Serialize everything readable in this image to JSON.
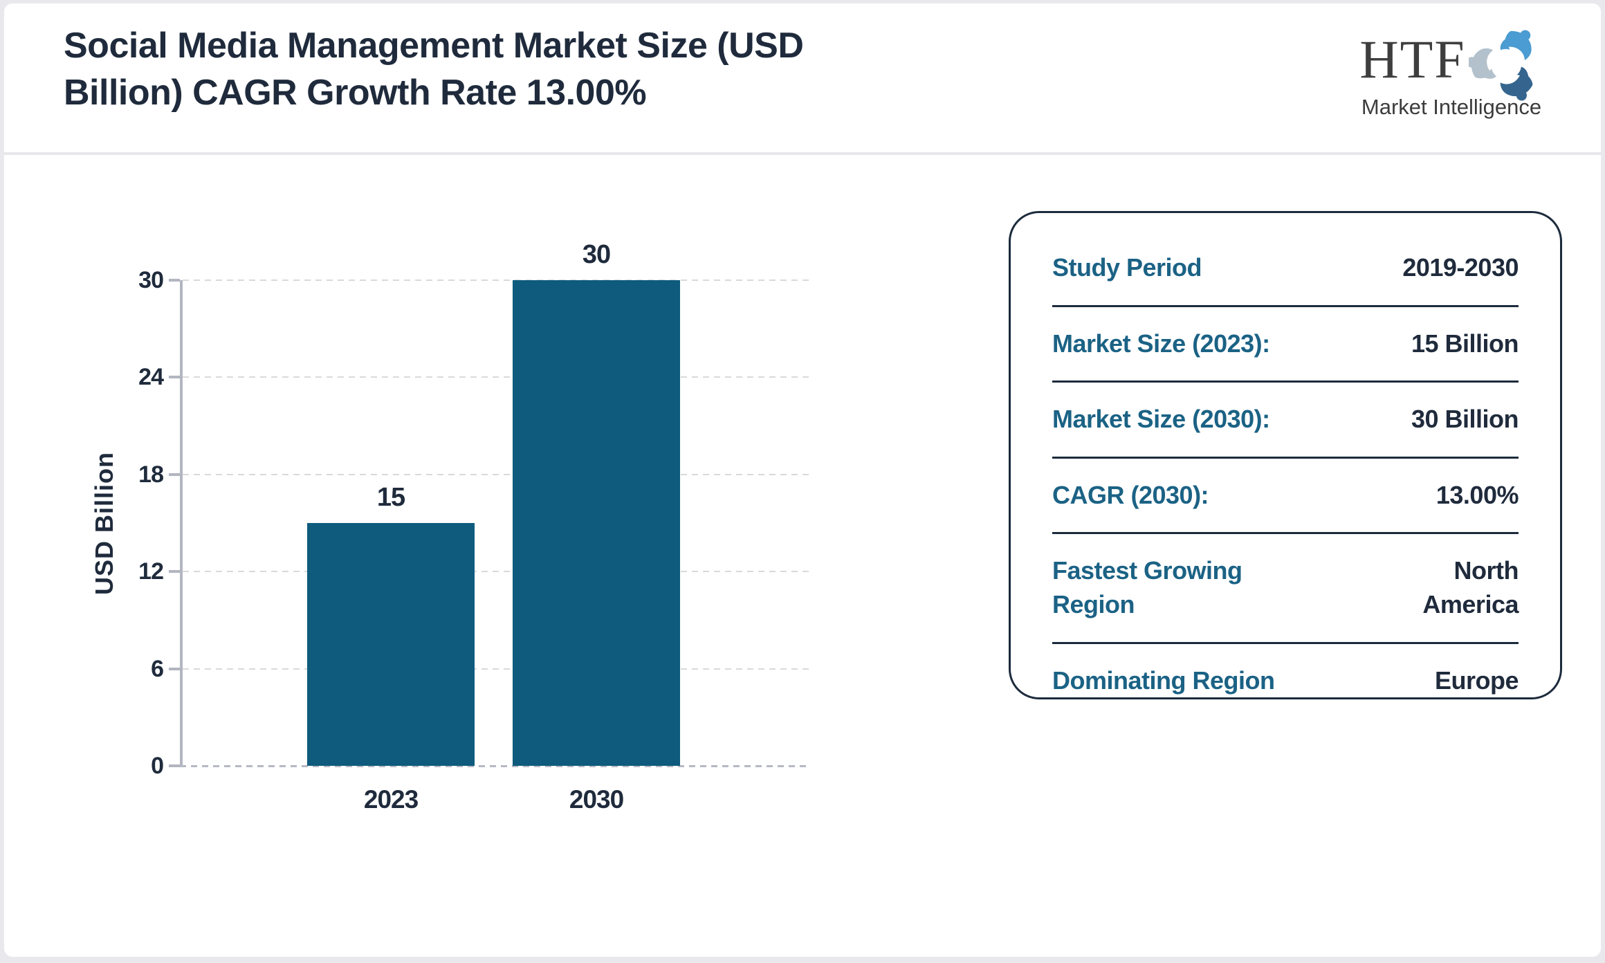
{
  "header": {
    "title": "Social Media Management Market Size (USD Billion) CAGR Growth Rate 13.00%"
  },
  "logo": {
    "name": "HTF",
    "tagline": "Market Intelligence",
    "icon": "triskelion-people-icon",
    "icon_colors": [
      "#4a9cd2",
      "#35658e",
      "#b3c1cc"
    ]
  },
  "chart_data": {
    "type": "bar",
    "categories": [
      "2023",
      "2030"
    ],
    "values": [
      15,
      30
    ],
    "bar_labels": [
      "15",
      "30"
    ],
    "title": "",
    "xlabel": "",
    "ylabel": "USD Billion",
    "ylim": [
      0,
      30
    ],
    "yticks": [
      0,
      6,
      12,
      18,
      24,
      30
    ],
    "grid": true,
    "legend": false,
    "bar_color": "#0e5b7e"
  },
  "info_panel": {
    "rows": [
      {
        "label": "Study Period",
        "value": "2019-2030"
      },
      {
        "label": "Market Size (2023):",
        "value": "15 Billion"
      },
      {
        "label": "Market Size (2030):",
        "value": "30 Billion"
      },
      {
        "label": "CAGR (2030):",
        "value": "13.00%"
      },
      {
        "label": "Fastest Growing\nRegion",
        "value": "North\nAmerica"
      },
      {
        "label": "Dominating Region",
        "value": "Europe"
      }
    ]
  },
  "colors": {
    "bar": "#0e5b7e",
    "label_teal": "#1b6285",
    "navy": "#1f2b3c",
    "axis_gray": "#b2b6c0",
    "grid_gray": "#d9d9d9",
    "page_edge": "#e9e9ed"
  }
}
